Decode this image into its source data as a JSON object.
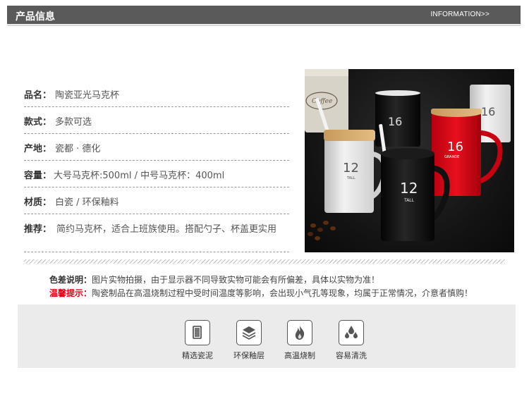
{
  "header": {
    "title": "产品信息",
    "link": "INFORMATION>>"
  },
  "specs": [
    {
      "label": "品名：",
      "value": "陶瓷亚光马克杯"
    },
    {
      "label": "款式：",
      "value": "多款可选"
    },
    {
      "label": "产地：",
      "value": "瓷都 · 德化"
    },
    {
      "label": "容量：",
      "value": "大号马克杯:500ml  / 中号马克杯：400ml"
    },
    {
      "label": "材质：",
      "value": "白瓷 / 环保釉料"
    },
    {
      "label": "推荐：",
      "value": "简约马克杯，适合上班族使用。搭配勺子、杯盖更实用"
    }
  ],
  "photo": {
    "mug_numbers": [
      "16",
      "16",
      "12",
      "12"
    ],
    "mug_sizes": [
      "GRANDE",
      "TALL"
    ],
    "canister_text": "Coffee"
  },
  "notes": [
    {
      "label": "色差说明：",
      "text": "图片实物拍摄，由于显示器不同导致实物可能会有所偏差，具体以实物为准！",
      "color": "#333333"
    },
    {
      "label": "温馨提示：",
      "text": "陶瓷制品在高温烧制过程中受时间温度等影响，会出现小气孔等现象，均属于正常情况，介意者慎购！",
      "color": "#e60012"
    }
  ],
  "features": [
    {
      "icon": "mug-icon",
      "label": "精选瓷泥"
    },
    {
      "icon": "layers-icon",
      "label": "环保釉层"
    },
    {
      "icon": "fire-icon",
      "label": "高温烧制"
    },
    {
      "icon": "water-drops-icon",
      "label": "容易清洗"
    }
  ]
}
